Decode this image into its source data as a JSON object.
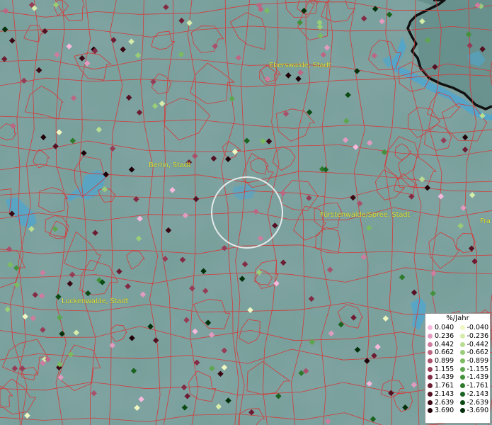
{
  "map": {
    "places": [
      {
        "name": "Eberswalde, Stadt"
      },
      {
        "name": "Berlin, Stadt"
      },
      {
        "name": "Fürstenwalde/Spree, Stadt"
      },
      {
        "name": "Luckenwalde, Stadt"
      },
      {
        "name": "Fra"
      }
    ],
    "colors": {
      "background": "#6f9794",
      "boundaries": "#d43a3a",
      "water": "#4fa6cf",
      "coast": "#111111",
      "label": "#e6e23a",
      "circle": "#f2f2f2"
    }
  },
  "legend": {
    "title": "%/Jahr",
    "positive": [
      {
        "label": "0.040",
        "color": "#f7b8dc"
      },
      {
        "label": "0.236",
        "color": "#e39ac0"
      },
      {
        "label": "0.442",
        "color": "#cf7c9f"
      },
      {
        "label": "0.662",
        "color": "#bd6684"
      },
      {
        "label": "0.899",
        "color": "#a9506b"
      },
      {
        "label": "1.155",
        "color": "#963c56"
      },
      {
        "label": "1.439",
        "color": "#832b44"
      },
      {
        "label": "1.761",
        "color": "#6e1c32"
      },
      {
        "label": "2.143",
        "color": "#551022"
      },
      {
        "label": "2.639",
        "color": "#3a0713"
      },
      {
        "label": "3.690",
        "color": "#200008"
      }
    ],
    "negative": [
      {
        "label": "-0.040",
        "color": "#f1f7c2"
      },
      {
        "label": "-0.236",
        "color": "#d6ecaa"
      },
      {
        "label": "-0.442",
        "color": "#b9de92"
      },
      {
        "label": "-0.662",
        "color": "#9acd78"
      },
      {
        "label": "-0.899",
        "color": "#7bbb62"
      },
      {
        "label": "-1.155",
        "color": "#5ea64d"
      },
      {
        "label": "-1.439",
        "color": "#44913c"
      },
      {
        "label": "-1.761",
        "color": "#2e7a2d"
      },
      {
        "label": "-2.143",
        "color": "#1b6320"
      },
      {
        "label": "-2.639",
        "color": "#0d4b14"
      },
      {
        "label": "-3.690",
        "color": "#03300a"
      }
    ]
  }
}
